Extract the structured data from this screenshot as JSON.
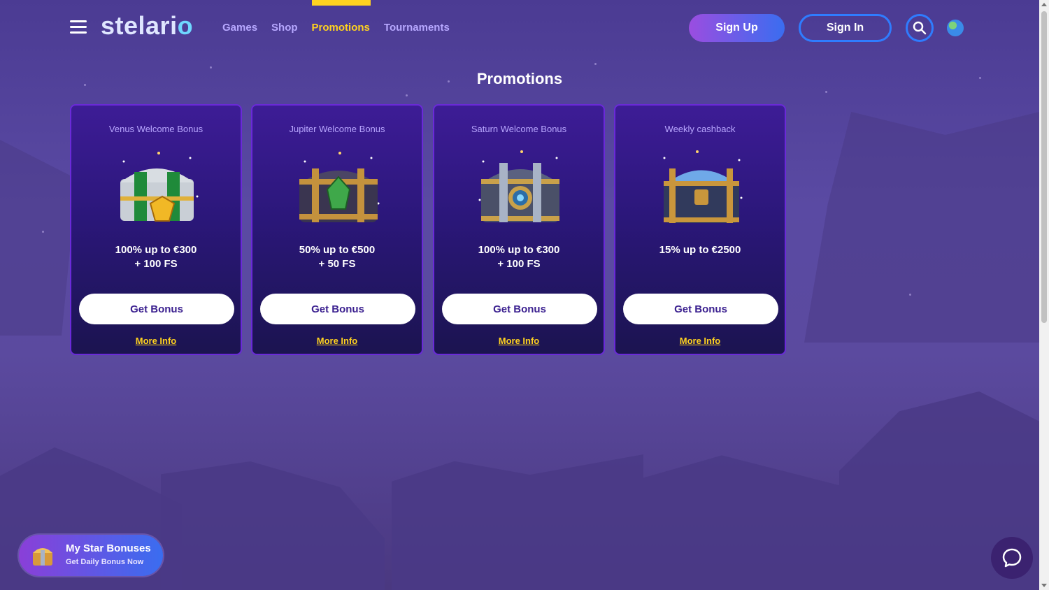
{
  "header": {
    "logo_text": "stelario",
    "nav": [
      "Games",
      "Shop",
      "Promotions",
      "Tournaments"
    ],
    "active_nav": "Promotions",
    "signup_label": "Sign Up",
    "signin_label": "Sign In"
  },
  "page": {
    "title": "Promotions"
  },
  "cards": [
    {
      "title": "Venus Welcome Bonus",
      "offer_line1": "100% up to €300",
      "offer_line2": "+ 100 FS",
      "button": "Get Bonus",
      "link": "More Info"
    },
    {
      "title": "Jupiter Welcome Bonus",
      "offer_line1": "50% up to €500",
      "offer_line2": "+ 50 FS",
      "button": "Get Bonus",
      "link": "More Info"
    },
    {
      "title": "Saturn Welcome Bonus",
      "offer_line1": "100% up to €300",
      "offer_line2": "+ 100 FS",
      "button": "Get Bonus",
      "link": "More Info"
    },
    {
      "title": "Weekly cashback",
      "offer_line1": "15% up to €2500",
      "offer_line2": "",
      "button": "Get Bonus",
      "link": "More Info"
    }
  ],
  "star_bonus": {
    "title": "My Star Bonuses",
    "subtitle": "Get Daily Bonus Now"
  },
  "colors": {
    "accent": "#ffd21f",
    "primary_blue": "#2f7cff",
    "card_border": "#6a2ad8"
  }
}
